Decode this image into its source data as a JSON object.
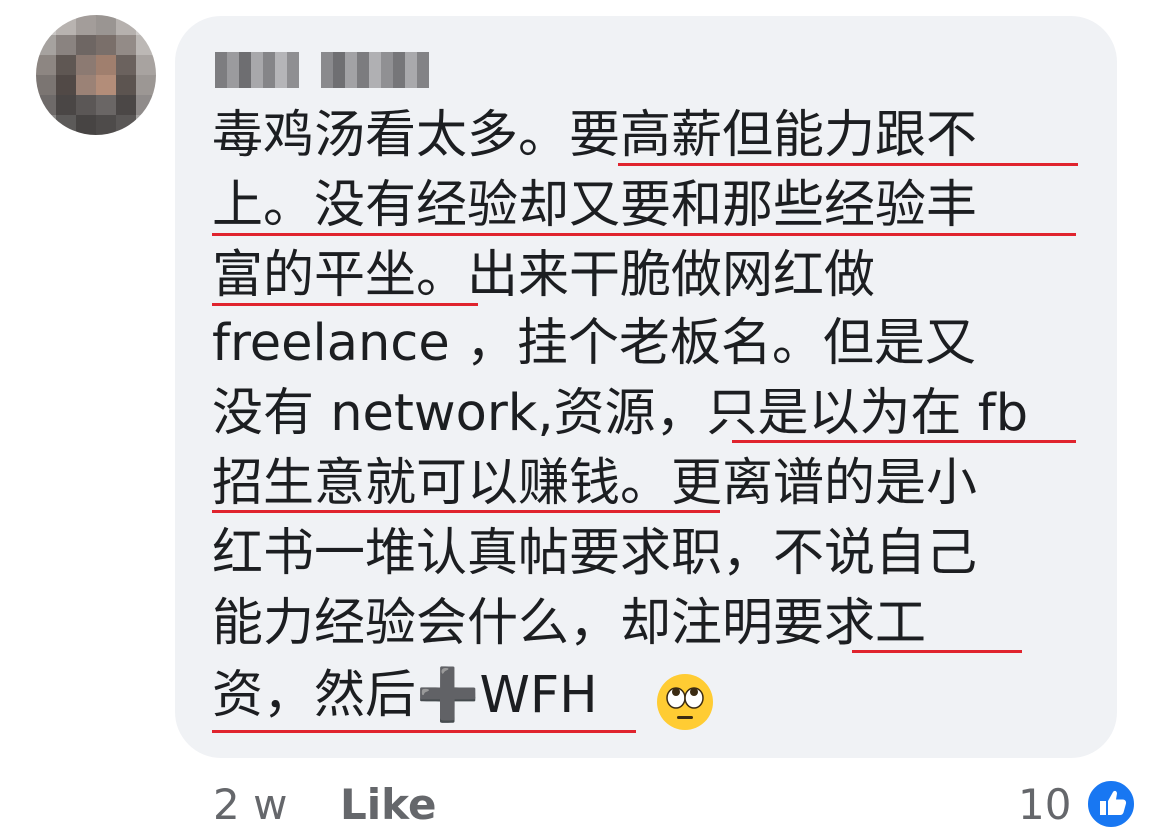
{
  "comment": {
    "author_name": "[blurred name]",
    "lines": [
      "毒鸡汤看太多。要高薪但能力跟不",
      "上。没有经验却又要和那些经验丰",
      "富的平坐。出来干脆做网红做",
      "freelance ，挂个老板名。但是又",
      "没有 network,资源，只是以为在 fb",
      "招生意就可以赚钱。更离谱的是小",
      "红书一堆认真帖要求职，不说自己",
      "能力经验会什么，却注明要求工",
      "资，然后➕WFH"
    ],
    "reaction_emoji": "face-with-rolling-eyes",
    "underline_color": "#e0242e"
  },
  "footer": {
    "time": "2 w",
    "like_label": "Like",
    "reaction_count": "10"
  },
  "colors": {
    "bubble_background": "#f0f2f5",
    "text": "#1c1e21",
    "meta_text": "#65676b",
    "like_badge": "#1877f2"
  },
  "icons": {
    "avatar": "pixelated-avatar",
    "reaction": "thumbs-up-icon",
    "emoji": "rolling-eyes-emoji"
  }
}
